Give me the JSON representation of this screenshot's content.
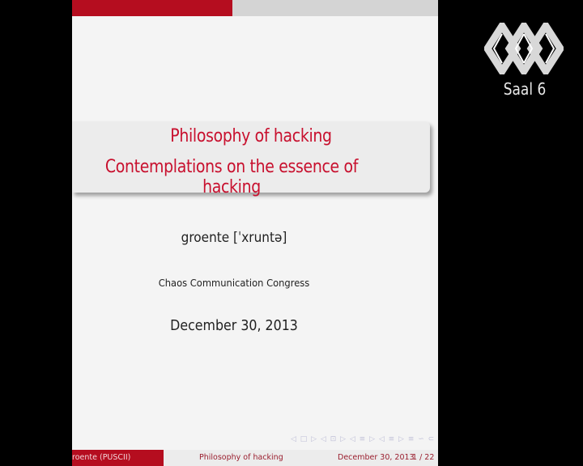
{
  "slide": {
    "title_line1": "Philosophy of hacking",
    "title_line2": "Contemplations on the essence of hacking",
    "author": "groente [ˈxruntə]",
    "event": "Chaos Communication Congress",
    "date": "December 30, 2013",
    "nav_symbols": "◁ □ ▷ ◁ ⊡ ▷ ◁ ≡ ▷ ◁ ≡ ▷ ≡ ∽ ⊂ ⊂",
    "footer": {
      "author": "groente (PUSCII)",
      "title": "Philosophy of hacking",
      "date": "December 30, 2013",
      "page": "1 / 22"
    }
  },
  "overlay": {
    "hall_label": "Saal 6",
    "logo_icon": "ccc-diamond-logo-icon"
  },
  "colors": {
    "accent_red": "#b50d1f",
    "title_red": "#c8102e",
    "slide_bg": "#f4f4f4"
  }
}
